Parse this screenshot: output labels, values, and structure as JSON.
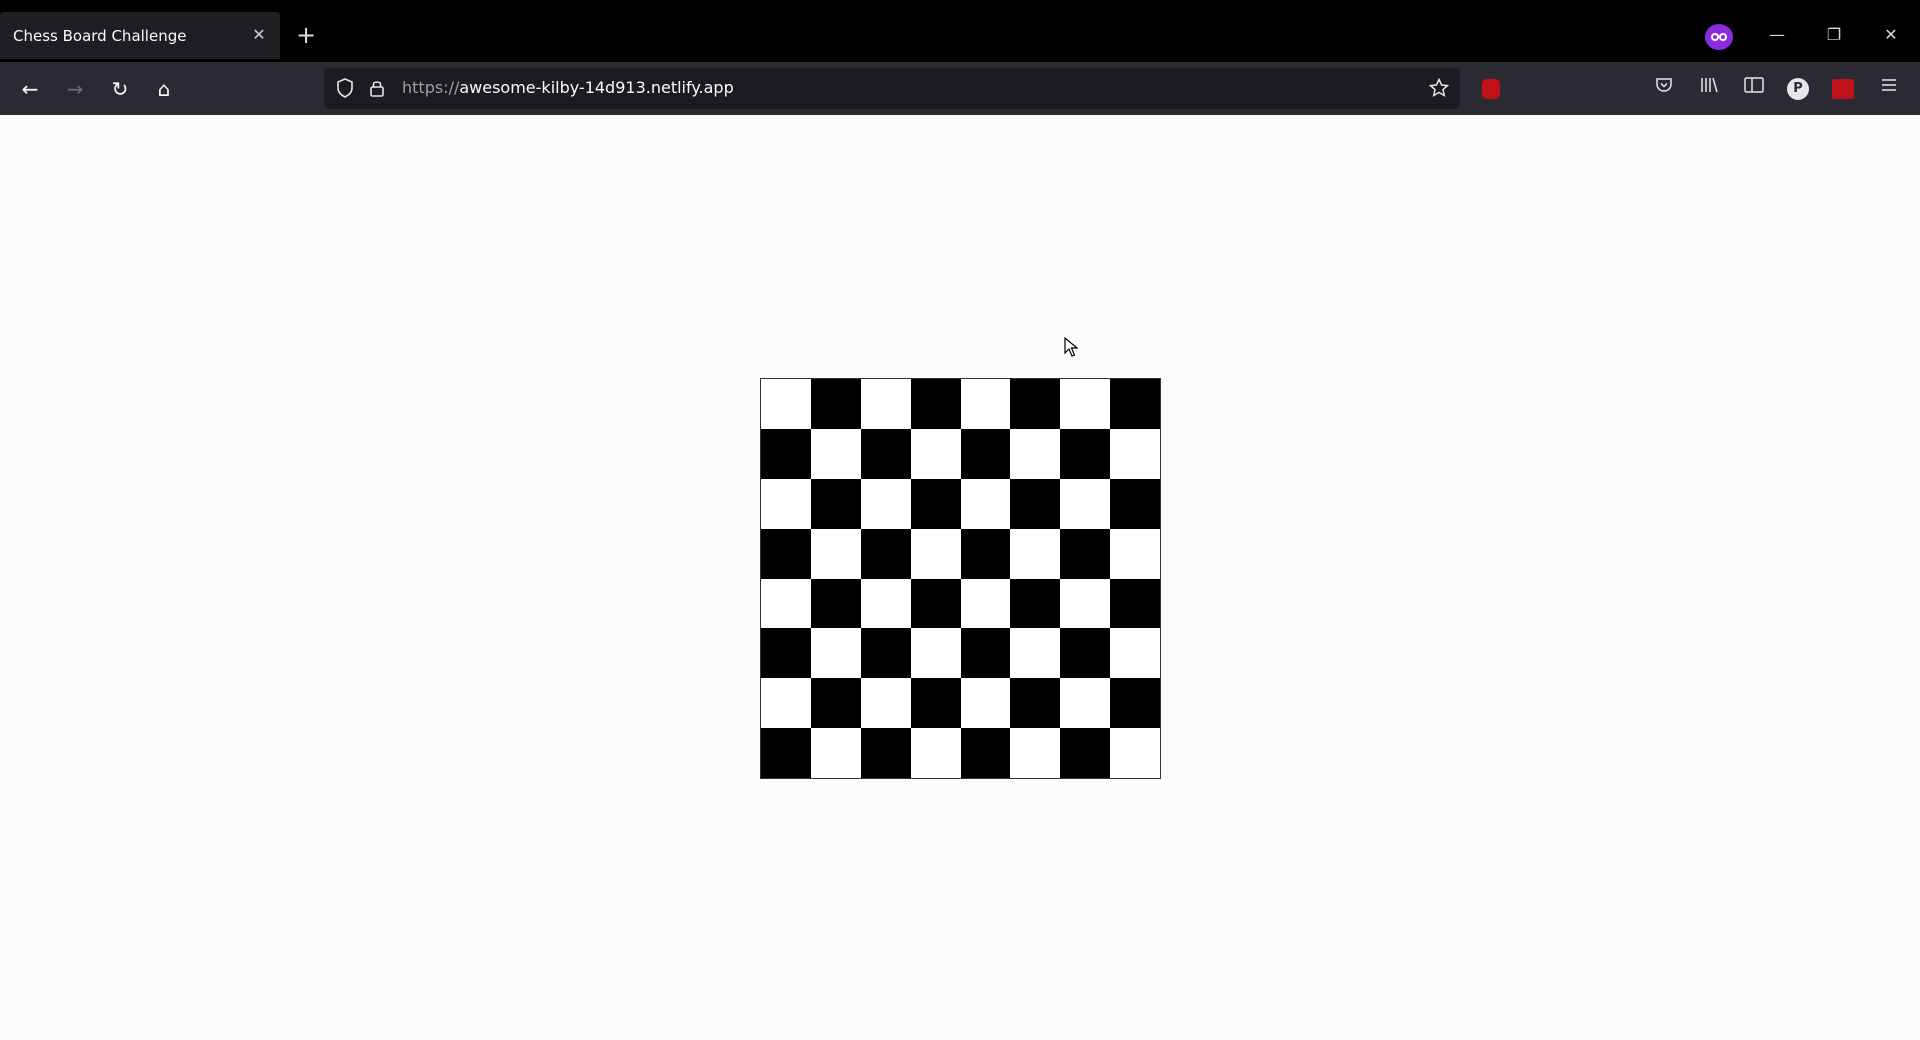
{
  "browser": {
    "tab": {
      "title": "Chess Board Challenge",
      "close_glyph": "✕"
    },
    "new_tab_glyph": "+",
    "window_controls": {
      "minimize": "—",
      "restore": "❐",
      "close": "✕"
    },
    "nav": {
      "back": "←",
      "forward": "→",
      "reload": "↻",
      "home": "⌂"
    },
    "url": {
      "scheme": "https://",
      "host": "awesome-kilby-14d913.netlify.app"
    },
    "toolbar_icons": [
      "shield-icon",
      "lock-icon",
      "bookmark-star-icon",
      "ublock-icon",
      "pocket-icon",
      "library-icon",
      "sidebar-icon",
      "profile-icon",
      "extension-icon",
      "menu-icon"
    ],
    "profile_letter": "P"
  },
  "board": {
    "rows": 8,
    "cols": 8,
    "first_square": "white",
    "colors": {
      "light": "#ffffff",
      "dark": "#000000"
    }
  }
}
